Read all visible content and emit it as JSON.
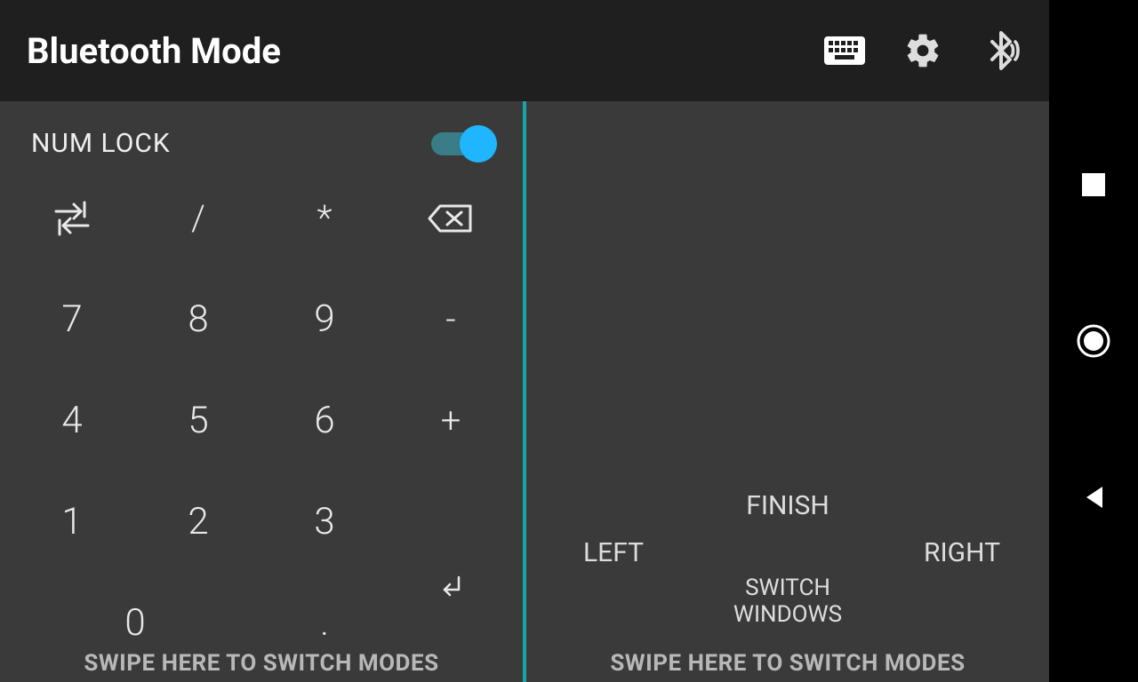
{
  "header": {
    "title": "Bluetooth Mode"
  },
  "left_pane": {
    "numlock_label": "NUM LOCK",
    "numlock_on": true,
    "keys": {
      "tab": "⇄",
      "divide": "/",
      "multiply": "*",
      "backspace": "⌫",
      "k7": "7",
      "k8": "8",
      "k9": "9",
      "minus": "-",
      "k4": "4",
      "k5": "5",
      "k6": "6",
      "plus": "+",
      "k1": "1",
      "k2": "2",
      "k3": "3",
      "k0": "0",
      "dot": ".",
      "enter": "↵"
    },
    "swipe_hint": "SWIPE HERE TO SWITCH MODES"
  },
  "right_pane": {
    "finish": "FINISH",
    "left": "LEFT",
    "right": "RIGHT",
    "switch_windows_line1": "SWITCH",
    "switch_windows_line2": "WINDOWS",
    "swipe_hint": "SWIPE HERE TO SWITCH MODES"
  }
}
